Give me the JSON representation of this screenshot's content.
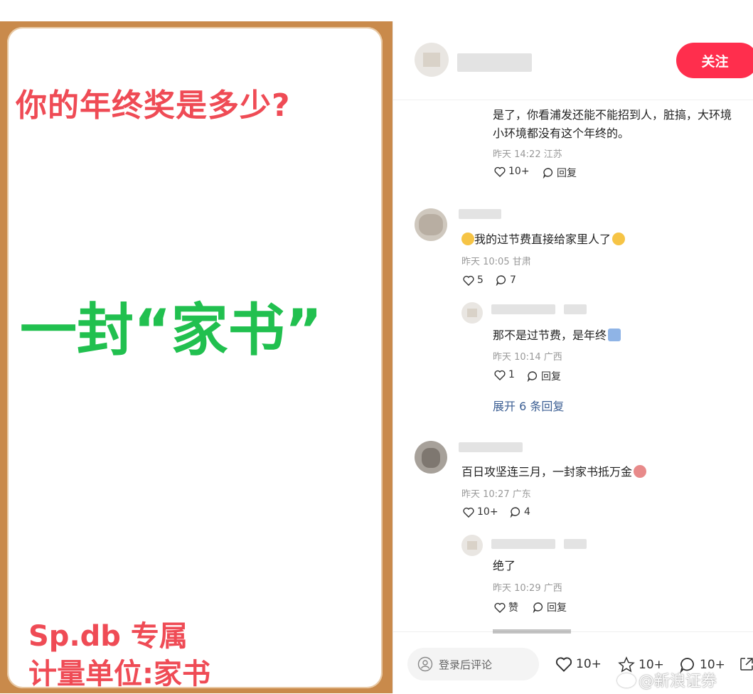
{
  "poster": {
    "question": "你的年终奖是多少?",
    "headline": "一封“家书”",
    "footer_line1": "Sp.db 专属",
    "footer_line2": "计量单位:家书"
  },
  "header": {
    "follow_label": "关注"
  },
  "comments": [
    {
      "text_line1": "是了，你看浦发还能不能招到人，脏搞，大环境",
      "text_line2": "小环境都没有这个年终的。",
      "meta": "昨天 14:22 江苏",
      "likes": "10+",
      "reply_label": "回复"
    },
    {
      "text": "我的过节费直接给家里人了",
      "meta": "昨天 10:05 甘肃",
      "likes": "5",
      "replies": "7",
      "sub_reply": {
        "text": "那不是过节费，是年终",
        "meta": "昨天 10:14 广西",
        "likes": "1",
        "reply_label": "回复"
      },
      "expand": "展开 6 条回复"
    },
    {
      "text": "百日攻坚连三月，一封家书抵万金",
      "meta": "昨天 10:27 广东",
      "likes": "10+",
      "replies": "4",
      "sub_reply": {
        "text": "绝了",
        "meta": "昨天 10:29 广西",
        "likes": "赞",
        "reply_label": "回复"
      }
    }
  ],
  "footer": {
    "login_placeholder": "登录后评论",
    "like_count": "10+",
    "star_count": "10+",
    "comment_count": "10+"
  },
  "watermark": "@新浪证券",
  "colors": {
    "follow": "#ff2e4d",
    "poster_red": "#ef4b55",
    "poster_green": "#21c04f",
    "frame": "#c98a4b",
    "link": "#3b5e93"
  }
}
